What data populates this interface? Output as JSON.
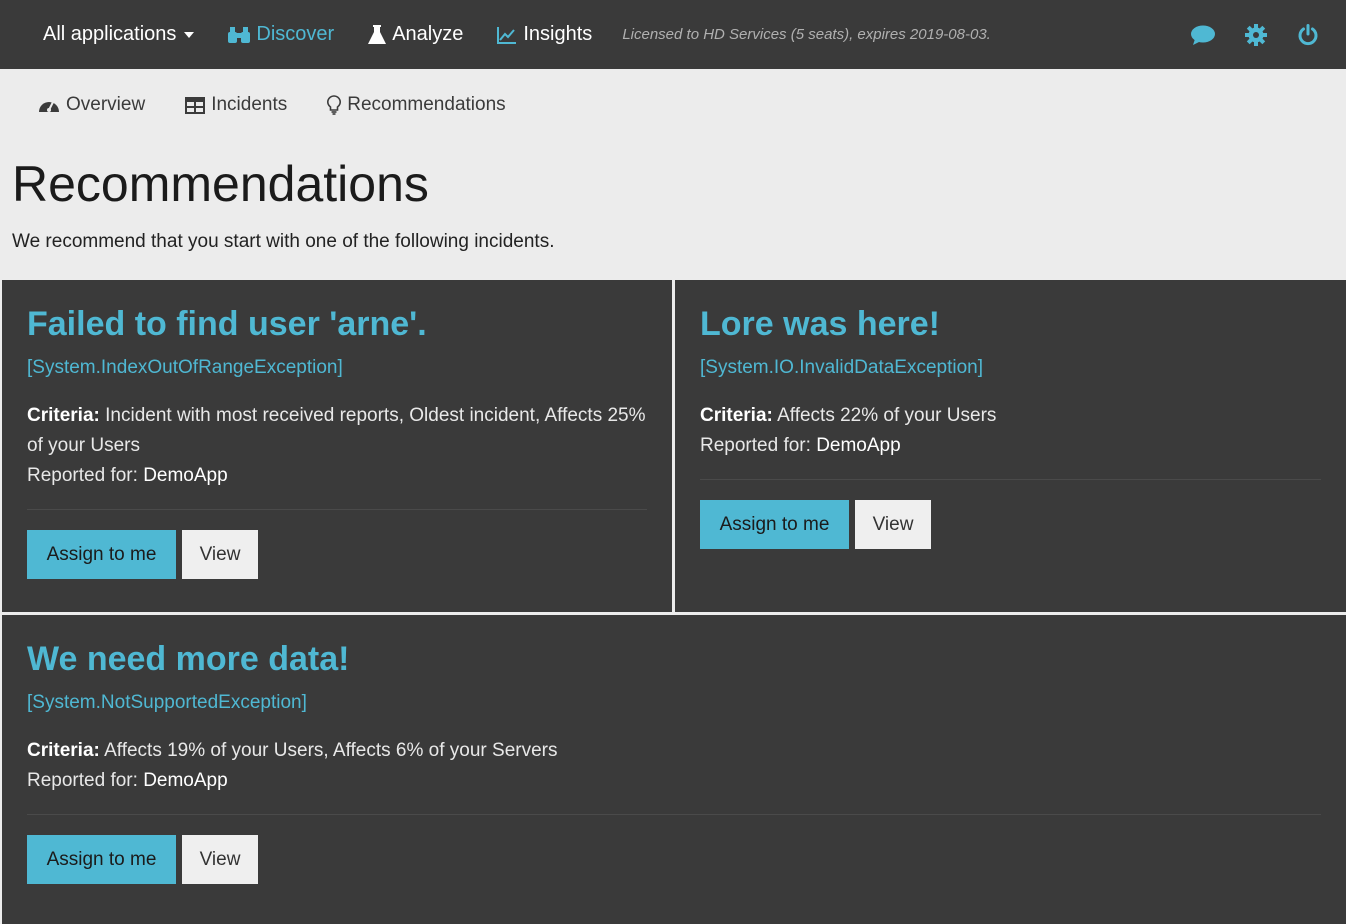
{
  "topnav": {
    "app_select": "All applications",
    "links": [
      {
        "label": "Discover",
        "icon": "binoculars-icon",
        "active": true
      },
      {
        "label": "Analyze",
        "icon": "flask-icon",
        "active": false
      },
      {
        "label": "Insights",
        "icon": "area-chart-icon",
        "active": false
      }
    ],
    "license": "Licensed to HD Services (5 seats), expires 2019-08-03.",
    "right_icons": [
      "chat-icon",
      "gear-icon",
      "power-icon"
    ]
  },
  "subnav": {
    "tabs": [
      {
        "label": "Overview",
        "icon": "dashboard-icon"
      },
      {
        "label": "Incidents",
        "icon": "table-icon"
      },
      {
        "label": "Recommendations",
        "icon": "lightbulb-icon"
      }
    ]
  },
  "page": {
    "title": "Recommendations",
    "subtitle": "We recommend that you start with one of the following incidents."
  },
  "cards": [
    {
      "title": "Failed to find user 'arne'.",
      "exception": "[System.IndexOutOfRangeException]",
      "criteria_label": "Criteria:",
      "criteria": "Incident with most received reports, Oldest incident, Affects 25% of your Users",
      "reported_label": "Reported for:",
      "app": "DemoApp",
      "assign_label": "Assign to me",
      "view_label": "View"
    },
    {
      "title": "Lore was here!",
      "exception": "[System.IO.InvalidDataException]",
      "criteria_label": "Criteria:",
      "criteria": "Affects 22% of your Users",
      "reported_label": "Reported for:",
      "app": "DemoApp",
      "assign_label": "Assign to me",
      "view_label": "View"
    },
    {
      "title": "We need more data!",
      "exception": "[System.NotSupportedException]",
      "criteria_label": "Criteria:",
      "criteria": "Affects 19% of your Users, Affects 6% of your Servers",
      "reported_label": "Reported for:",
      "app": "DemoApp",
      "assign_label": "Assign to me",
      "view_label": "View"
    }
  ],
  "colors": {
    "accent": "#4fb8d3",
    "nav_bg": "#3a3a3a",
    "page_bg": "#ececec"
  }
}
